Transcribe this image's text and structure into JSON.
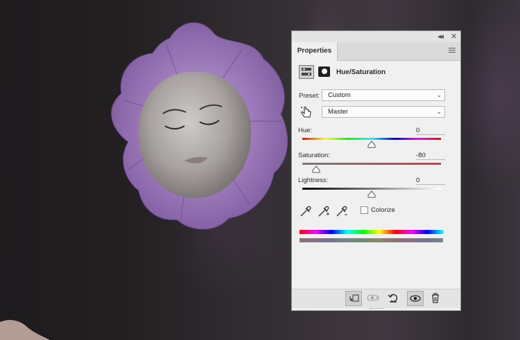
{
  "panel": {
    "title_tab": "Properties",
    "adjustment_title": "Hue/Saturation",
    "preset_label": "Preset:",
    "preset_value": "Custom",
    "channel_value": "Master",
    "hue_label": "Hue:",
    "hue_value": "0",
    "saturation_label": "Saturation:",
    "saturation_value": "-80",
    "lightness_label": "Lightness:",
    "lightness_value": "0",
    "colorize_label": "Colorize",
    "colorize_checked": false,
    "slider_levels": {
      "hue_fraction": 0.5,
      "saturation_fraction": 0.1,
      "lightness_fraction": 0.5
    }
  },
  "icons": {
    "collapse": "double-chevron-left-icon",
    "close": "close-icon",
    "panel_menu": "hamburger-menu-icon",
    "adjustment": "hue-saturation-icon",
    "mask": "mask-icon",
    "target_adjust": "hand-targeted-adjustment-icon",
    "eyedropper": "eyedropper-icon",
    "eyedropper_add": "eyedropper-add-icon",
    "eyedropper_subtract": "eyedropper-subtract-icon",
    "clip": "clip-to-layer-icon",
    "view_previous": "view-previous-state-icon",
    "reset": "reset-icon",
    "visibility": "eye-icon",
    "delete": "trash-icon"
  },
  "colors": {
    "panel_bg": "#f0f0f0",
    "slider_red": "#d83a3a"
  }
}
